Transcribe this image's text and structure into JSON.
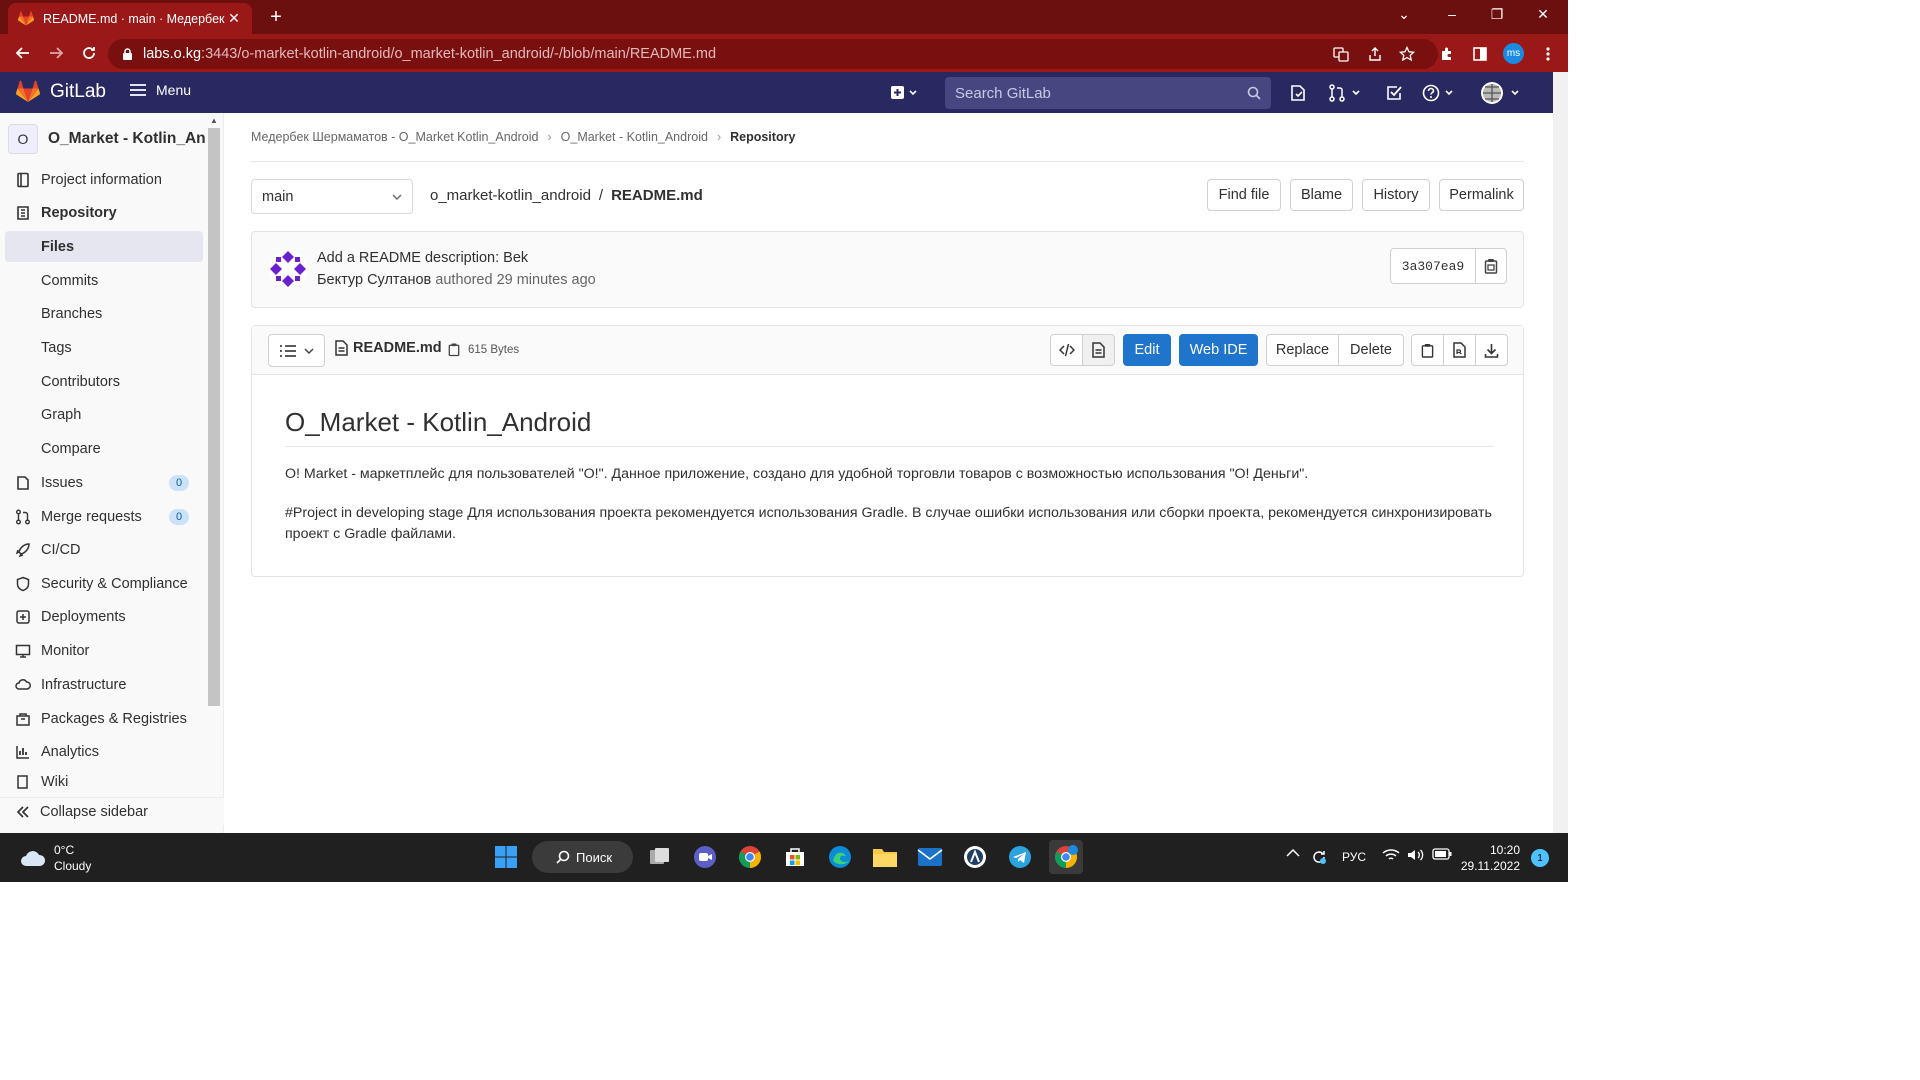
{
  "browser": {
    "tab_title": "README.md · main · Медербек Ш",
    "url_host": "labs.o.kg",
    "url_path": ":3443/o-market-kotlin-android/o_market-kotlin_android/-/blob/main/README.md",
    "profile_initials": "ms"
  },
  "gitlab_header": {
    "brand": "GitLab",
    "menu_label": "Menu",
    "search_placeholder": "Search GitLab"
  },
  "sidebar": {
    "project_initial": "O",
    "project_name": "O_Market - Kotlin_Andr..",
    "items": [
      {
        "label": "Project information",
        "icon": "info-icon"
      },
      {
        "label": "Repository",
        "icon": "repository-icon"
      },
      {
        "label": "Files",
        "icon": ""
      },
      {
        "label": "Commits",
        "icon": ""
      },
      {
        "label": "Branches",
        "icon": ""
      },
      {
        "label": "Tags",
        "icon": ""
      },
      {
        "label": "Contributors",
        "icon": ""
      },
      {
        "label": "Graph",
        "icon": ""
      },
      {
        "label": "Compare",
        "icon": ""
      },
      {
        "label": "Issues",
        "icon": "issues-icon",
        "badge": "0"
      },
      {
        "label": "Merge requests",
        "icon": "merge-request-icon",
        "badge": "0"
      },
      {
        "label": "CI/CD",
        "icon": "rocket-icon"
      },
      {
        "label": "Security & Compliance",
        "icon": "shield-icon"
      },
      {
        "label": "Deployments",
        "icon": "deployments-icon"
      },
      {
        "label": "Monitor",
        "icon": "monitor-icon"
      },
      {
        "label": "Infrastructure",
        "icon": "cloud-icon"
      },
      {
        "label": "Packages & Registries",
        "icon": "package-icon"
      },
      {
        "label": "Analytics",
        "icon": "chart-icon"
      },
      {
        "label": "Wiki",
        "icon": "book-icon"
      }
    ],
    "collapse_label": "Collapse sidebar"
  },
  "breadcrumb": {
    "owner": "Медербек Шермаматов - O_Market Kotlin_Android",
    "project": "O_Market - Kotlin_Android",
    "current": "Repository"
  },
  "file_nav": {
    "branch": "main",
    "repo_path": "o_market-kotlin_android",
    "file_name": "README.md",
    "buttons": {
      "find_file": "Find file",
      "blame": "Blame",
      "history": "History",
      "permalink": "Permalink"
    }
  },
  "commit": {
    "title": "Add a README description: Bek",
    "author": "Бектур Султанов",
    "meta": "authored 29 minutes ago",
    "sha": "3a307ea9"
  },
  "file_header": {
    "name": "README.md",
    "size": "615 Bytes",
    "buttons": {
      "edit": "Edit",
      "web_ide": "Web IDE",
      "replace": "Replace",
      "delete": "Delete"
    }
  },
  "readme": {
    "heading": "O_Market - Kotlin_Android",
    "paragraph1": "O! Market - маркетплейс для пользователей \"O!\". Данное приложение, создано для удобной торговли товаров с возможностью использования \"O! Деньги\".",
    "paragraph2": "#Project in developing stage Для использования проекта рекомендуется использования Gradle. В случае ошибки использования или сборки проекта, рекомендуется синхронизировать проект с Gradle файлами."
  },
  "taskbar": {
    "temperature": "0°C",
    "weather": "Cloudy",
    "search_label": "Поиск",
    "language": "РУС",
    "time": "10:20",
    "date": "29.11.2022",
    "notifications": "1"
  },
  "colors": {
    "chrome_frame": "#6b0f0f",
    "chrome_toolbar": "#9b1818",
    "gitlab_header": "#292961",
    "primary_button": "#1f75cb"
  }
}
